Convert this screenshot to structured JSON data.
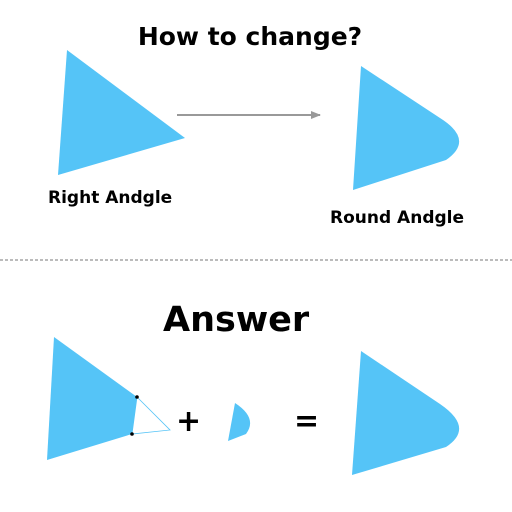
{
  "header": {
    "title": "How to change?"
  },
  "top_diagram": {
    "left_label": "Right Andgle",
    "right_label": "Round Andgle"
  },
  "answer": {
    "title": "Answer",
    "plus_symbol": "+",
    "equals_symbol": "="
  },
  "colors": {
    "shape_fill": "#55C4F7",
    "arrow": "#999999",
    "divider": "#777777",
    "text": "#000000",
    "background": "#FFFFFF"
  }
}
